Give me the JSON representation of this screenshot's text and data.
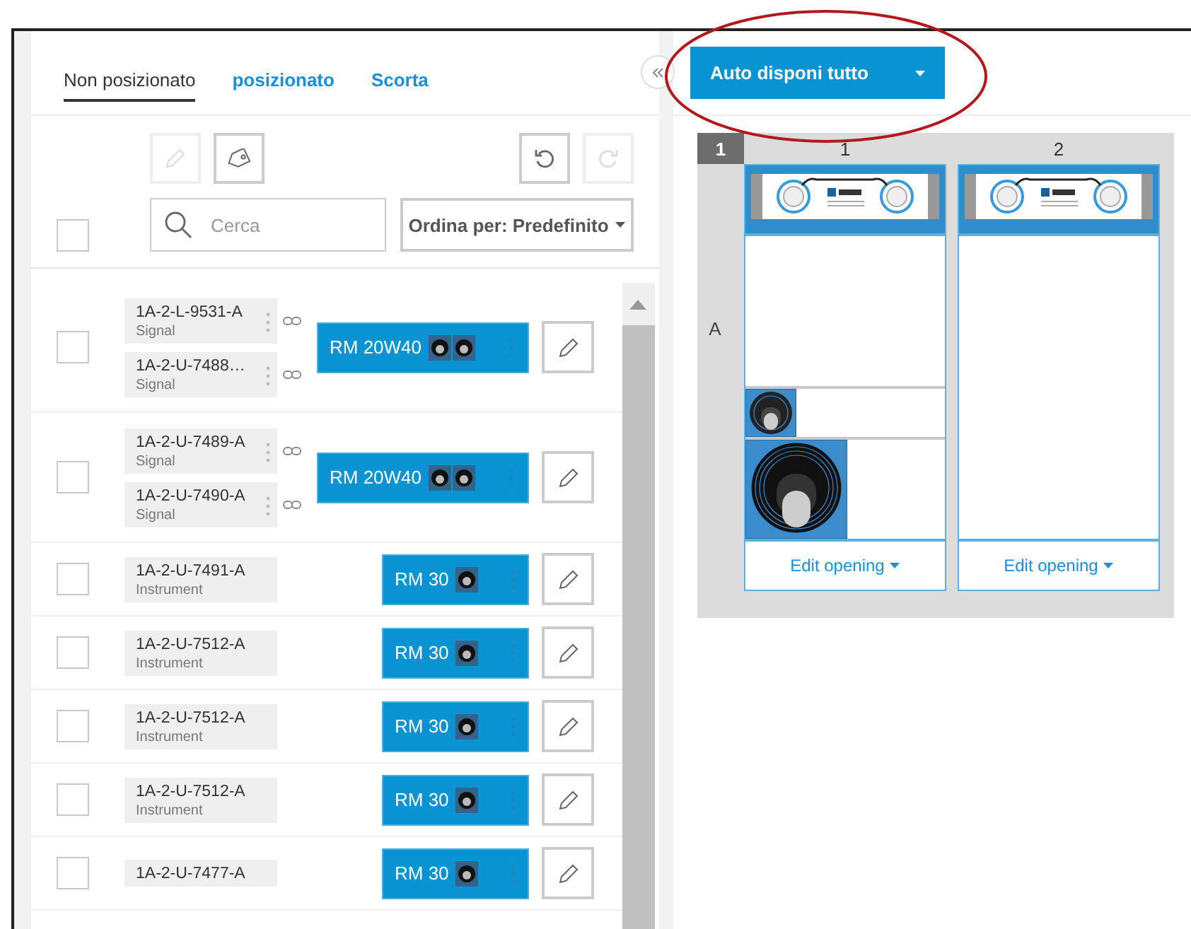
{
  "tabs": [
    {
      "label": "Non posizionato",
      "selected": true
    },
    {
      "label": "posizionato",
      "selected": false
    },
    {
      "label": "Scorta",
      "selected": false
    }
  ],
  "toolbar": {
    "tools": [
      {
        "kind": "edit",
        "disabled": true
      },
      {
        "kind": "tag",
        "disabled": false
      },
      {
        "kind": "undo",
        "disabled": false
      },
      {
        "kind": "redo",
        "disabled": true
      }
    ],
    "select_all": {
      "checked": false
    },
    "search": {
      "placeholder": "Cerca"
    },
    "sort": {
      "label": "Ordina per: Predefinito"
    }
  },
  "items": [
    {
      "checked": false,
      "cables": [
        {
          "id": "1A-2-L-9531-A",
          "type": "Signal"
        },
        {
          "id": "1A-2-U-7488…",
          "type": "Signal"
        }
      ],
      "module": {
        "label": "RM 20W40",
        "kind": "double"
      }
    },
    {
      "checked": false,
      "cables": [
        {
          "id": "1A-2-U-7489-A",
          "type": "Signal"
        },
        {
          "id": "1A-2-U-7490-A",
          "type": "Signal"
        }
      ],
      "module": {
        "label": "RM 20W40",
        "kind": "double"
      }
    },
    {
      "checked": false,
      "cables": [
        {
          "id": "1A-2-U-7491-A",
          "type": "Instrument"
        }
      ],
      "module": {
        "label": "RM 30",
        "kind": "single"
      }
    },
    {
      "checked": false,
      "cables": [
        {
          "id": "1A-2-U-7512-A",
          "type": "Instrument"
        }
      ],
      "module": {
        "label": "RM 30",
        "kind": "single"
      }
    },
    {
      "checked": false,
      "cables": [
        {
          "id": "1A-2-U-7512-A",
          "type": "Instrument"
        }
      ],
      "module": {
        "label": "RM 30",
        "kind": "single"
      }
    },
    {
      "checked": false,
      "cables": [
        {
          "id": "1A-2-U-7512-A",
          "type": "Instrument"
        }
      ],
      "module": {
        "label": "RM 30",
        "kind": "single"
      }
    },
    {
      "checked": false,
      "cables": [
        {
          "id": "1A-2-U-7477-A"
        }
      ],
      "module": {
        "label": "RM 30",
        "kind": "single"
      }
    }
  ],
  "auto_button": {
    "label": "Auto disponi tutto"
  },
  "rack": {
    "corner": "1",
    "rows": [
      {
        "label": "A"
      }
    ],
    "columns": [
      {
        "label": "1",
        "modules": [
          {
            "kind": "small"
          },
          {
            "kind": "large"
          }
        ],
        "action": "Edit opening"
      },
      {
        "label": "2",
        "action": "Edit opening"
      }
    ]
  }
}
